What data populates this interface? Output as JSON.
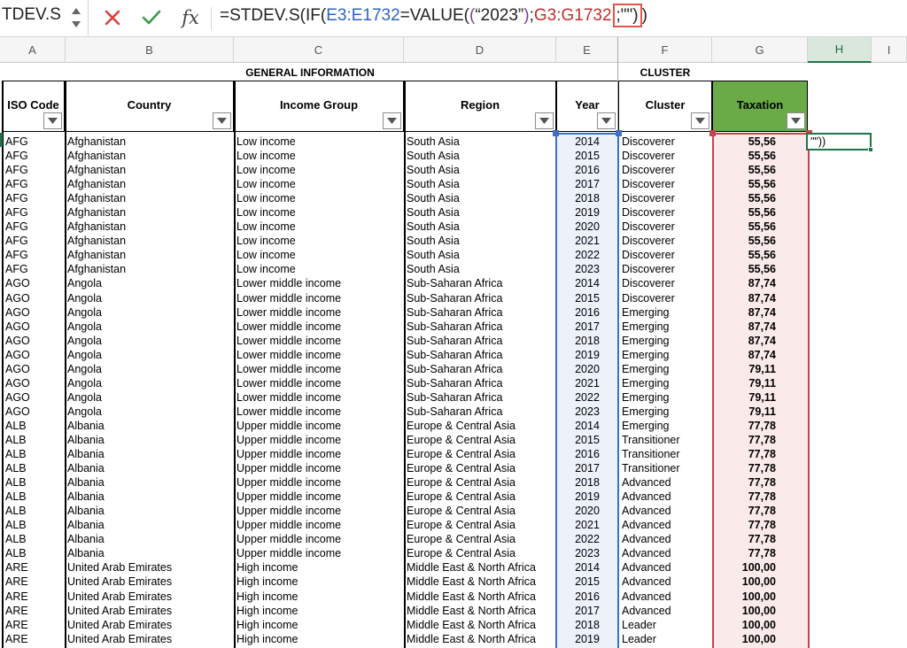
{
  "formula_bar": {
    "name_box": "TDEV.S",
    "fx": "fx",
    "formula_parts": [
      {
        "text": "=STDEV.S(IF(",
        "cls": ""
      },
      {
        "text": "E3:E1732",
        "cls": "f-blue"
      },
      {
        "text": "=VALUE(",
        "cls": ""
      },
      {
        "text": "(",
        "cls": "f-purple"
      },
      {
        "text": "“2023”",
        "cls": ""
      },
      {
        "text": ")",
        "cls": "f-purple"
      },
      {
        "text": ";",
        "cls": ""
      },
      {
        "text": "G3:G1732",
        "cls": "f-red"
      }
    ],
    "formula_boxed": ";\"\")",
    "formula_tail": ")"
  },
  "columns": [
    "A",
    "B",
    "C",
    "D",
    "E",
    "F",
    "G",
    "H",
    "I"
  ],
  "group_headers": {
    "general": "GENERAL INFORMATION",
    "cluster": "CLUSTER"
  },
  "table_headers": {
    "iso": "ISO Code",
    "country": "Country",
    "income": "Income Group",
    "region": "Region",
    "year": "Year",
    "cluster": "Cluster",
    "tax": "Taxation"
  },
  "active_cell_text": "\"\"))",
  "colors": {
    "taxation_header": "#6aab47",
    "year_selection": "#3d6fc2",
    "tax_selection": "#c9444a",
    "active": "#217346"
  },
  "rows": [
    [
      "AFG",
      "Afghanistan",
      "Low income",
      "South Asia",
      "2014",
      "Discoverer",
      "55,56"
    ],
    [
      "AFG",
      "Afghanistan",
      "Low income",
      "South Asia",
      "2015",
      "Discoverer",
      "55,56"
    ],
    [
      "AFG",
      "Afghanistan",
      "Low income",
      "South Asia",
      "2016",
      "Discoverer",
      "55,56"
    ],
    [
      "AFG",
      "Afghanistan",
      "Low income",
      "South Asia",
      "2017",
      "Discoverer",
      "55,56"
    ],
    [
      "AFG",
      "Afghanistan",
      "Low income",
      "South Asia",
      "2018",
      "Discoverer",
      "55,56"
    ],
    [
      "AFG",
      "Afghanistan",
      "Low income",
      "South Asia",
      "2019",
      "Discoverer",
      "55,56"
    ],
    [
      "AFG",
      "Afghanistan",
      "Low income",
      "South Asia",
      "2020",
      "Discoverer",
      "55,56"
    ],
    [
      "AFG",
      "Afghanistan",
      "Low income",
      "South Asia",
      "2021",
      "Discoverer",
      "55,56"
    ],
    [
      "AFG",
      "Afghanistan",
      "Low income",
      "South Asia",
      "2022",
      "Discoverer",
      "55,56"
    ],
    [
      "AFG",
      "Afghanistan",
      "Low income",
      "South Asia",
      "2023",
      "Discoverer",
      "55,56"
    ],
    [
      "AGO",
      "Angola",
      "Lower middle income",
      "Sub-Saharan Africa",
      "2014",
      "Discoverer",
      "87,74"
    ],
    [
      "AGO",
      "Angola",
      "Lower middle income",
      "Sub-Saharan Africa",
      "2015",
      "Discoverer",
      "87,74"
    ],
    [
      "AGO",
      "Angola",
      "Lower middle income",
      "Sub-Saharan Africa",
      "2016",
      "Emerging",
      "87,74"
    ],
    [
      "AGO",
      "Angola",
      "Lower middle income",
      "Sub-Saharan Africa",
      "2017",
      "Emerging",
      "87,74"
    ],
    [
      "AGO",
      "Angola",
      "Lower middle income",
      "Sub-Saharan Africa",
      "2018",
      "Emerging",
      "87,74"
    ],
    [
      "AGO",
      "Angola",
      "Lower middle income",
      "Sub-Saharan Africa",
      "2019",
      "Emerging",
      "87,74"
    ],
    [
      "AGO",
      "Angola",
      "Lower middle income",
      "Sub-Saharan Africa",
      "2020",
      "Emerging",
      "79,11"
    ],
    [
      "AGO",
      "Angola",
      "Lower middle income",
      "Sub-Saharan Africa",
      "2021",
      "Emerging",
      "79,11"
    ],
    [
      "AGO",
      "Angola",
      "Lower middle income",
      "Sub-Saharan Africa",
      "2022",
      "Emerging",
      "79,11"
    ],
    [
      "AGO",
      "Angola",
      "Lower middle income",
      "Sub-Saharan Africa",
      "2023",
      "Emerging",
      "79,11"
    ],
    [
      "ALB",
      "Albania",
      "Upper middle income",
      "Europe & Central Asia",
      "2014",
      "Emerging",
      "77,78"
    ],
    [
      "ALB",
      "Albania",
      "Upper middle income",
      "Europe & Central Asia",
      "2015",
      "Transitioner",
      "77,78"
    ],
    [
      "ALB",
      "Albania",
      "Upper middle income",
      "Europe & Central Asia",
      "2016",
      "Transitioner",
      "77,78"
    ],
    [
      "ALB",
      "Albania",
      "Upper middle income",
      "Europe & Central Asia",
      "2017",
      "Transitioner",
      "77,78"
    ],
    [
      "ALB",
      "Albania",
      "Upper middle income",
      "Europe & Central Asia",
      "2018",
      "Advanced",
      "77,78"
    ],
    [
      "ALB",
      "Albania",
      "Upper middle income",
      "Europe & Central Asia",
      "2019",
      "Advanced",
      "77,78"
    ],
    [
      "ALB",
      "Albania",
      "Upper middle income",
      "Europe & Central Asia",
      "2020",
      "Advanced",
      "77,78"
    ],
    [
      "ALB",
      "Albania",
      "Upper middle income",
      "Europe & Central Asia",
      "2021",
      "Advanced",
      "77,78"
    ],
    [
      "ALB",
      "Albania",
      "Upper middle income",
      "Europe & Central Asia",
      "2022",
      "Advanced",
      "77,78"
    ],
    [
      "ALB",
      "Albania",
      "Upper middle income",
      "Europe & Central Asia",
      "2023",
      "Advanced",
      "77,78"
    ],
    [
      "ARE",
      "United Arab Emirates",
      "High income",
      "Middle East & North Africa",
      "2014",
      "Advanced",
      "100,00"
    ],
    [
      "ARE",
      "United Arab Emirates",
      "High income",
      "Middle East & North Africa",
      "2015",
      "Advanced",
      "100,00"
    ],
    [
      "ARE",
      "United Arab Emirates",
      "High income",
      "Middle East & North Africa",
      "2016",
      "Advanced",
      "100,00"
    ],
    [
      "ARE",
      "United Arab Emirates",
      "High income",
      "Middle East & North Africa",
      "2017",
      "Advanced",
      "100,00"
    ],
    [
      "ARE",
      "United Arab Emirates",
      "High income",
      "Middle East & North Africa",
      "2018",
      "Leader",
      "100,00"
    ],
    [
      "ARE",
      "United Arab Emirates",
      "High income",
      "Middle East & North Africa",
      "2019",
      "Leader",
      "100,00"
    ]
  ]
}
